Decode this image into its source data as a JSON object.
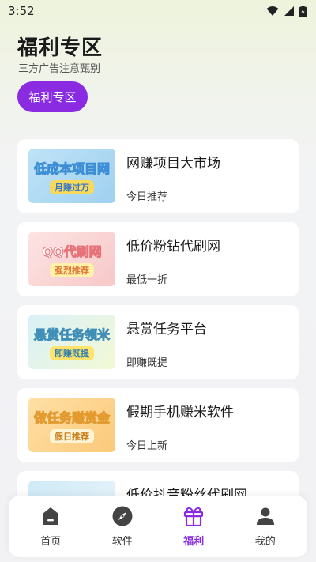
{
  "status_bar": {
    "time": "3:52"
  },
  "header": {
    "title": "福利专区",
    "subtitle": "三方广告注意甄别",
    "tag_button": "福利专区"
  },
  "list": [
    {
      "title": "网赚项目大市场",
      "subtitle": "今日推荐",
      "thumb_main": "低成本项目网",
      "thumb_sub": "月赚过万"
    },
    {
      "title": "低价粉钻代刷网",
      "subtitle": "最低一折",
      "thumb_main": "QQ代刷网",
      "thumb_sub": "强烈推荐"
    },
    {
      "title": "悬赏任务平台",
      "subtitle": "即赚既提",
      "thumb_main": "悬赏任务领米",
      "thumb_sub": "即赚既提"
    },
    {
      "title": "假期手机赚米软件",
      "subtitle": "今日上新",
      "thumb_main": "做任务赚赏金",
      "thumb_sub": "假日推荐"
    },
    {
      "title": "低价抖音粉丝代刷网",
      "subtitle": "",
      "thumb_main": "",
      "thumb_sub": ""
    }
  ],
  "bottom_nav": [
    {
      "label": "首页",
      "icon": "home-icon"
    },
    {
      "label": "软件",
      "icon": "compass-icon"
    },
    {
      "label": "福利",
      "icon": "gift-icon",
      "active": true
    },
    {
      "label": "我的",
      "icon": "user-icon"
    }
  ],
  "colors": {
    "accent": "#8a2be2",
    "background": "#f2f2f4",
    "card": "#ffffff"
  }
}
